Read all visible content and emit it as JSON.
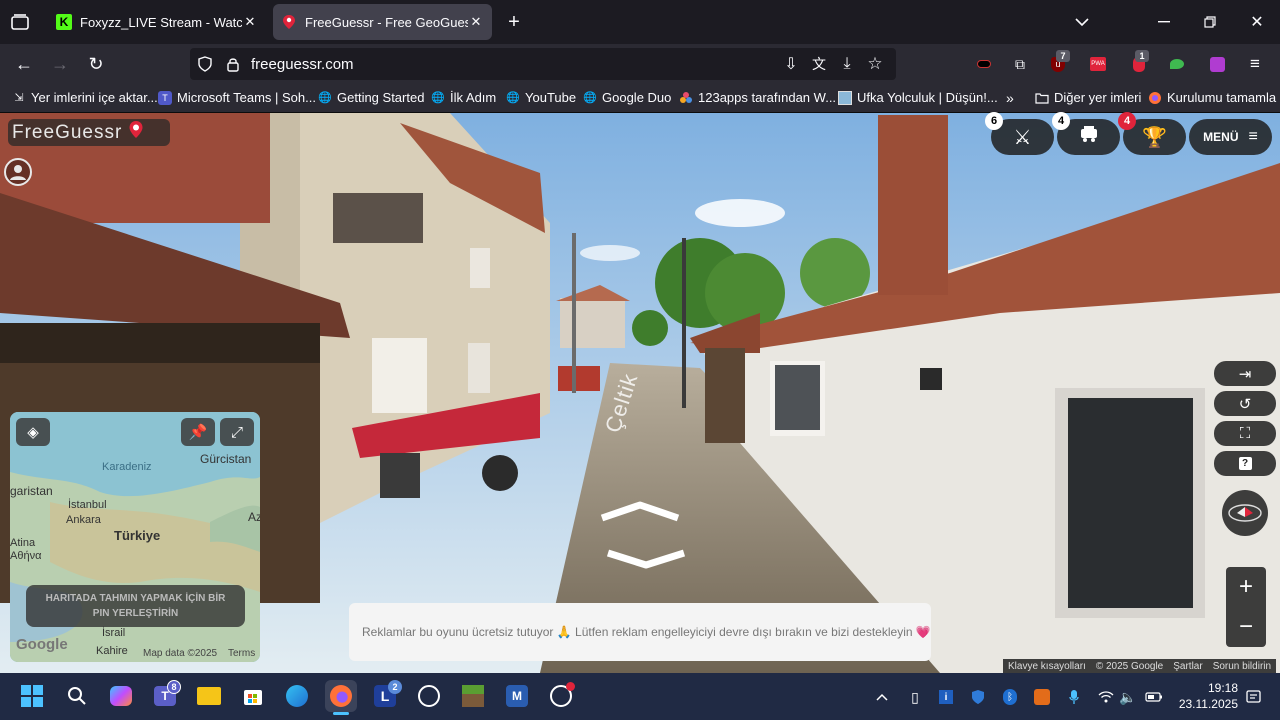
{
  "browser": {
    "tabs": [
      {
        "label": "Foxyzz_LIVE Stream - Watch Live",
        "active": false,
        "favicon": "kick-logo-icon"
      },
      {
        "label": "FreeGuessr - Free GeoGuessr Al",
        "active": true,
        "favicon": "freeguessr-pin-icon"
      }
    ],
    "url": "freeguessr.com",
    "bookmarks": [
      "Yer imlerini içe aktar...",
      "Microsoft Teams | Soh...",
      "Getting Started",
      "İlk Adım",
      "YouTube",
      "Google Duo",
      "123apps tarafından W...",
      "Ufka Yolculuk | Düşün!...",
      "Diğer yer imleri",
      "Kurulumu tamamla"
    ],
    "extension_badges": {
      "ublock": "7",
      "ext2": "1"
    }
  },
  "game": {
    "logo": "FreeGuessr",
    "buttons": {
      "battle_badge": "6",
      "party_badge": "4",
      "trophy_badge": "4",
      "menu_label": "MENÜ"
    },
    "street_label": "Çeltik",
    "minimap": {
      "labels": [
        "Karadeniz",
        "garistan",
        "İstanbul",
        "Ankara",
        "Türkiye",
        "Gürcistan",
        "Az",
        "Atina",
        "Αθήνα",
        "İsrail",
        "Kahire"
      ],
      "pin_hint": "HARITADA TAHMIN YAPMAK İÇİN BİR PIN YERLEŞTİRİN",
      "google": "Google",
      "map_data": "Map data ©2025",
      "terms": "Terms"
    },
    "ad_banner": "Reklamlar bu oyunu ücretsiz tutuyor 🙏 Lütfen reklam engelleyiciyi devre dışı bırakın ve bizi destekleyin 💗",
    "footer": {
      "shortcuts": "Klavye kısayolları",
      "copyright": "© 2025 Google",
      "terms": "Şartlar",
      "report": "Sorun bildirin"
    }
  },
  "taskbar": {
    "teams_badge": "8",
    "lc_badge": "2",
    "time": "19:18",
    "date": "23.11.2025"
  },
  "colors": {
    "chrome_bg": "#1c1b22",
    "toolbar_bg": "#2b2a33",
    "active_tab": "#42414d",
    "badge_red": "#e0243b",
    "taskbar": "#202a44"
  }
}
